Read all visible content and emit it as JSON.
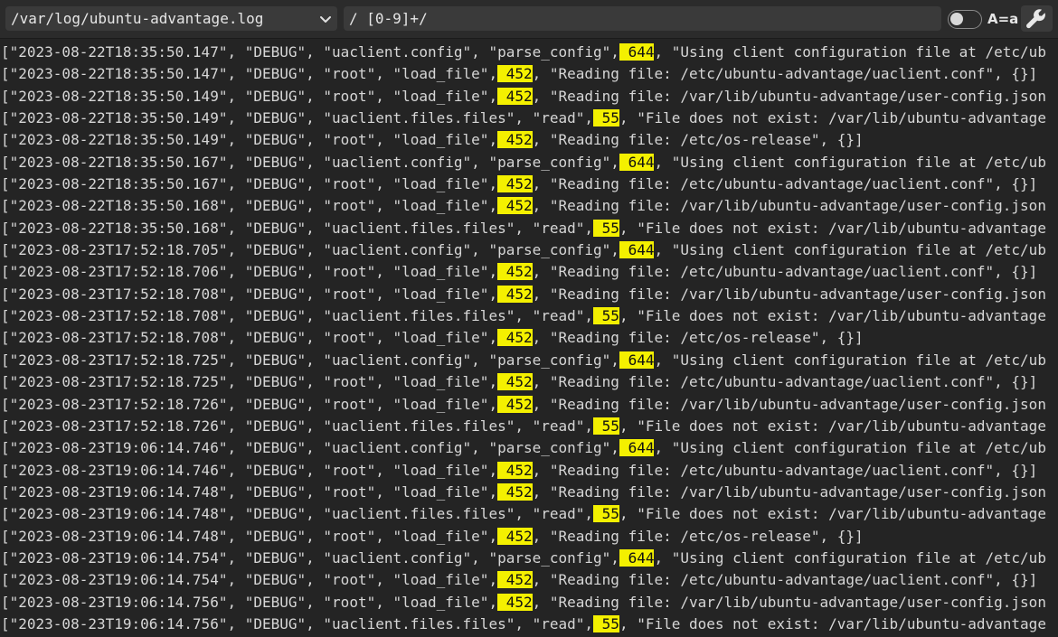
{
  "toolbar": {
    "file_path": "/var/log/ubuntu-advantage.log",
    "search_query": "/ [0-9]+/",
    "case_label": "A=a",
    "file_dropdown_icon": "chevron-down-icon",
    "settings_icon": "wrench-icon",
    "case_toggle_on": false
  },
  "highlight_color": "#f4f000",
  "log_lines": [
    {
      "pre": "[\"2023-08-22T18:35:50.147\", \"DEBUG\", \"uaclient.config\", \"parse_config\",",
      "match": " 644",
      "post": ", \"Using client configuration file at /etc/ub"
    },
    {
      "pre": "[\"2023-08-22T18:35:50.147\", \"DEBUG\", \"root\", \"load_file\",",
      "match": " 452",
      "post": ", \"Reading file: /etc/ubuntu-advantage/uaclient.conf\", {}]"
    },
    {
      "pre": "[\"2023-08-22T18:35:50.149\", \"DEBUG\", \"root\", \"load_file\",",
      "match": " 452",
      "post": ", \"Reading file: /var/lib/ubuntu-advantage/user-config.json"
    },
    {
      "pre": "[\"2023-08-22T18:35:50.149\", \"DEBUG\", \"uaclient.files.files\", \"read\",",
      "match": " 55",
      "post": ", \"File does not exist: /var/lib/ubuntu-advantage"
    },
    {
      "pre": "[\"2023-08-22T18:35:50.149\", \"DEBUG\", \"root\", \"load_file\",",
      "match": " 452",
      "post": ", \"Reading file: /etc/os-release\", {}]"
    },
    {
      "pre": "[\"2023-08-22T18:35:50.167\", \"DEBUG\", \"uaclient.config\", \"parse_config\",",
      "match": " 644",
      "post": ", \"Using client configuration file at /etc/ub"
    },
    {
      "pre": "[\"2023-08-22T18:35:50.167\", \"DEBUG\", \"root\", \"load_file\",",
      "match": " 452",
      "post": ", \"Reading file: /etc/ubuntu-advantage/uaclient.conf\", {}]"
    },
    {
      "pre": "[\"2023-08-22T18:35:50.168\", \"DEBUG\", \"root\", \"load_file\",",
      "match": " 452",
      "post": ", \"Reading file: /var/lib/ubuntu-advantage/user-config.json"
    },
    {
      "pre": "[\"2023-08-22T18:35:50.168\", \"DEBUG\", \"uaclient.files.files\", \"read\",",
      "match": " 55",
      "post": ", \"File does not exist: /var/lib/ubuntu-advantage"
    },
    {
      "pre": "[\"2023-08-23T17:52:18.705\", \"DEBUG\", \"uaclient.config\", \"parse_config\",",
      "match": " 644",
      "post": ", \"Using client configuration file at /etc/ub"
    },
    {
      "pre": "[\"2023-08-23T17:52:18.706\", \"DEBUG\", \"root\", \"load_file\",",
      "match": " 452",
      "post": ", \"Reading file: /etc/ubuntu-advantage/uaclient.conf\", {}]"
    },
    {
      "pre": "[\"2023-08-23T17:52:18.708\", \"DEBUG\", \"root\", \"load_file\",",
      "match": " 452",
      "post": ", \"Reading file: /var/lib/ubuntu-advantage/user-config.json"
    },
    {
      "pre": "[\"2023-08-23T17:52:18.708\", \"DEBUG\", \"uaclient.files.files\", \"read\",",
      "match": " 55",
      "post": ", \"File does not exist: /var/lib/ubuntu-advantage"
    },
    {
      "pre": "[\"2023-08-23T17:52:18.708\", \"DEBUG\", \"root\", \"load_file\",",
      "match": " 452",
      "post": ", \"Reading file: /etc/os-release\", {}]"
    },
    {
      "pre": "[\"2023-08-23T17:52:18.725\", \"DEBUG\", \"uaclient.config\", \"parse_config\",",
      "match": " 644",
      "post": ", \"Using client configuration file at /etc/ub"
    },
    {
      "pre": "[\"2023-08-23T17:52:18.725\", \"DEBUG\", \"root\", \"load_file\",",
      "match": " 452",
      "post": ", \"Reading file: /etc/ubuntu-advantage/uaclient.conf\", {}]"
    },
    {
      "pre": "[\"2023-08-23T17:52:18.726\", \"DEBUG\", \"root\", \"load_file\",",
      "match": " 452",
      "post": ", \"Reading file: /var/lib/ubuntu-advantage/user-config.json"
    },
    {
      "pre": "[\"2023-08-23T17:52:18.726\", \"DEBUG\", \"uaclient.files.files\", \"read\",",
      "match": " 55",
      "post": ", \"File does not exist: /var/lib/ubuntu-advantage"
    },
    {
      "pre": "[\"2023-08-23T19:06:14.746\", \"DEBUG\", \"uaclient.config\", \"parse_config\",",
      "match": " 644",
      "post": ", \"Using client configuration file at /etc/ub"
    },
    {
      "pre": "[\"2023-08-23T19:06:14.746\", \"DEBUG\", \"root\", \"load_file\",",
      "match": " 452",
      "post": ", \"Reading file: /etc/ubuntu-advantage/uaclient.conf\", {}]"
    },
    {
      "pre": "[\"2023-08-23T19:06:14.748\", \"DEBUG\", \"root\", \"load_file\",",
      "match": " 452",
      "post": ", \"Reading file: /var/lib/ubuntu-advantage/user-config.json"
    },
    {
      "pre": "[\"2023-08-23T19:06:14.748\", \"DEBUG\", \"uaclient.files.files\", \"read\",",
      "match": " 55",
      "post": ", \"File does not exist: /var/lib/ubuntu-advantage"
    },
    {
      "pre": "[\"2023-08-23T19:06:14.748\", \"DEBUG\", \"root\", \"load_file\",",
      "match": " 452",
      "post": ", \"Reading file: /etc/os-release\", {}]"
    },
    {
      "pre": "[\"2023-08-23T19:06:14.754\", \"DEBUG\", \"uaclient.config\", \"parse_config\",",
      "match": " 644",
      "post": ", \"Using client configuration file at /etc/ub"
    },
    {
      "pre": "[\"2023-08-23T19:06:14.754\", \"DEBUG\", \"root\", \"load_file\",",
      "match": " 452",
      "post": ", \"Reading file: /etc/ubuntu-advantage/uaclient.conf\", {}]"
    },
    {
      "pre": "[\"2023-08-23T19:06:14.756\", \"DEBUG\", \"root\", \"load_file\",",
      "match": " 452",
      "post": ", \"Reading file: /var/lib/ubuntu-advantage/user-config.json"
    },
    {
      "pre": "[\"2023-08-23T19:06:14.756\", \"DEBUG\", \"uaclient.files.files\", \"read\",",
      "match": " 55",
      "post": ", \"File does not exist: /var/lib/ubuntu-advantage"
    }
  ]
}
